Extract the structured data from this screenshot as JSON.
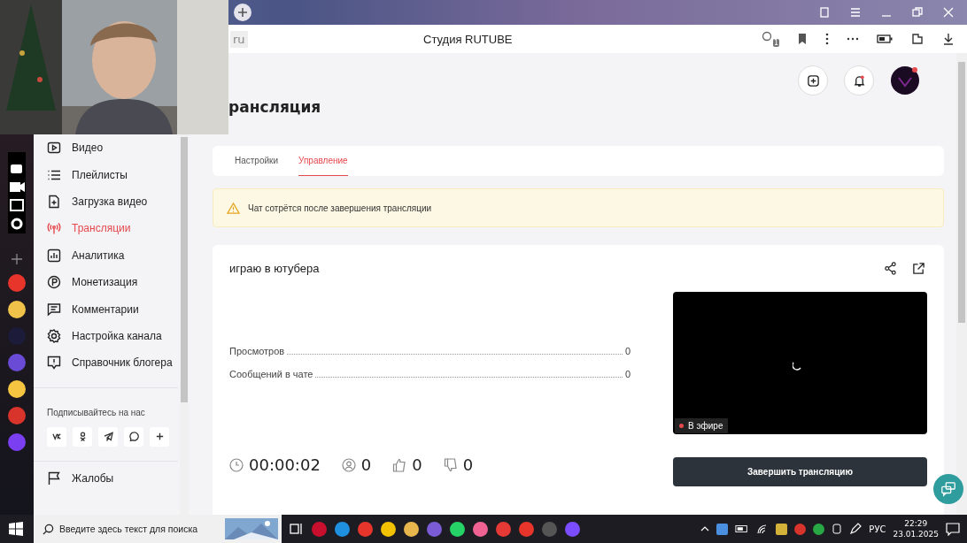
{
  "browser": {
    "address_fragment": "ru",
    "page_title": "Студия RUTUBE",
    "tracker_count": "1"
  },
  "header": {
    "page_heading": "рансляция"
  },
  "sidebar": {
    "items": [
      {
        "kind": "video",
        "label": "Видео",
        "selected": false
      },
      {
        "kind": "list",
        "label": "Плейлисты",
        "selected": false
      },
      {
        "kind": "upload",
        "label": "Загрузка видео",
        "selected": false
      },
      {
        "kind": "broadcast",
        "label": "Трансляции",
        "selected": true
      },
      {
        "kind": "analytics",
        "label": "Аналитика",
        "selected": false
      },
      {
        "kind": "money",
        "label": "Монетизация",
        "selected": false
      },
      {
        "kind": "comments",
        "label": "Комментарии",
        "selected": false
      },
      {
        "kind": "gear",
        "label": "Настройка канала",
        "selected": false
      },
      {
        "kind": "info",
        "label": "Справочник блогера",
        "selected": false
      }
    ],
    "follow_label": "Подписывайтесь на нас",
    "socials": [
      {
        "kind": "vk"
      },
      {
        "kind": "ok"
      },
      {
        "kind": "telegram"
      },
      {
        "kind": "viber"
      },
      {
        "kind": "plus"
      }
    ],
    "complaints": "Жалобы"
  },
  "tabs": [
    {
      "label": "Настройки",
      "selected": false
    },
    {
      "label": "Управление",
      "selected": true
    }
  ],
  "alert": "Чат сотрётся после завершения трансляции",
  "stream": {
    "title": "играю в ютубера",
    "stats": [
      {
        "label": "Просмотров",
        "value": "0"
      },
      {
        "label": "Сообщений в чате",
        "value": "0"
      }
    ],
    "live_badge": "В эфире",
    "counters": [
      {
        "kind": "time",
        "value": "00:00:02"
      },
      {
        "kind": "viewers",
        "value": "0"
      },
      {
        "kind": "likes",
        "value": "0"
      },
      {
        "kind": "dislikes",
        "value": "0"
      }
    ],
    "end_button": "Завершить трансляцию"
  },
  "taskbar": {
    "search_placeholder": "Введите здесь текст для поиска",
    "language": "РУС",
    "time": "22:29",
    "date": "23.01.2025"
  }
}
